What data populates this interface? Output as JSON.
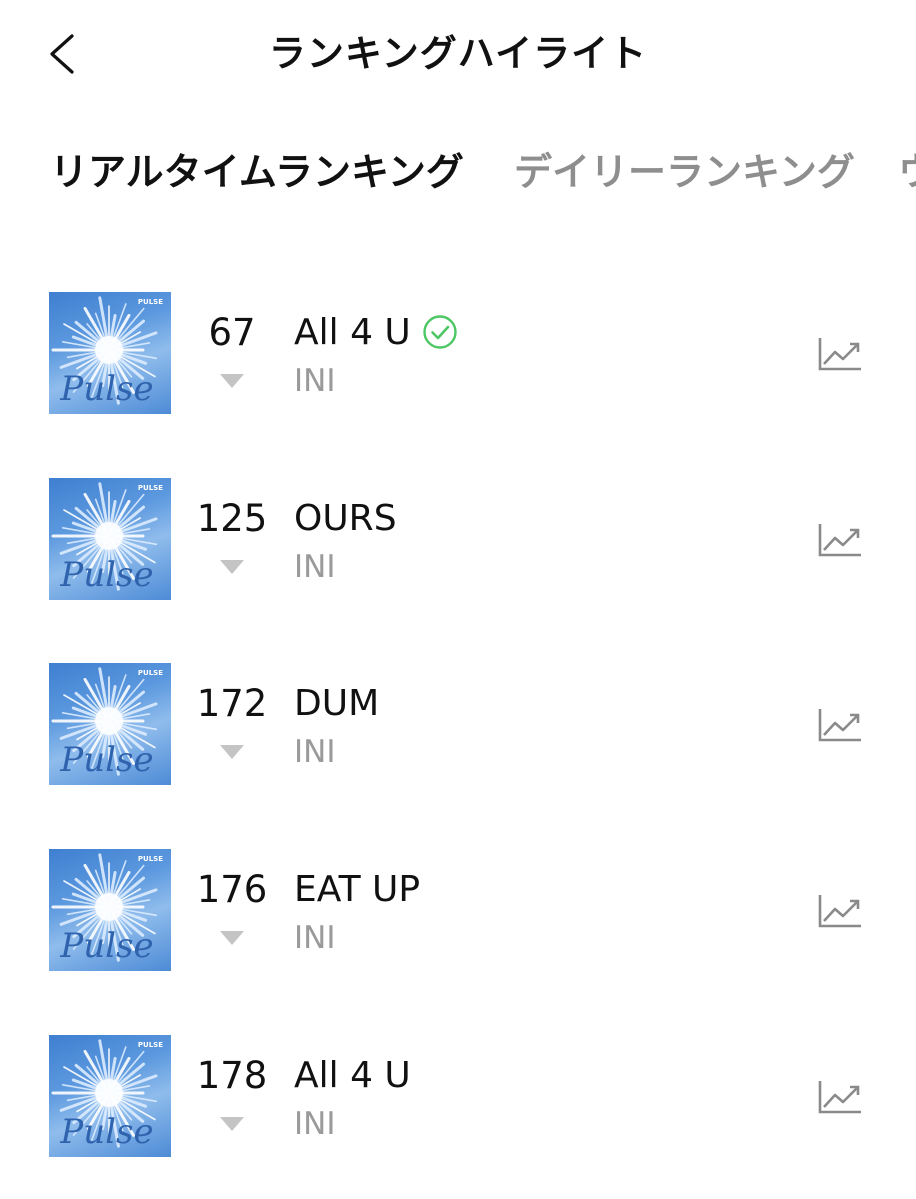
{
  "header": {
    "title": "ランキングハイライト"
  },
  "tabs": [
    {
      "label": "リアルタイムランキング",
      "active": true
    },
    {
      "label": "デイリーランキング",
      "active": false
    },
    {
      "label": "ウ",
      "active": false
    }
  ],
  "cover_art": {
    "brand": "PULSE",
    "script": "Pulse"
  },
  "rows": [
    {
      "rank": "67",
      "title": "All 4 U",
      "artist": "INI",
      "trend": "down",
      "verified": true
    },
    {
      "rank": "125",
      "title": "OURS",
      "artist": "INI",
      "trend": "down",
      "verified": false
    },
    {
      "rank": "172",
      "title": "DUM",
      "artist": "INI",
      "trend": "down",
      "verified": false
    },
    {
      "rank": "176",
      "title": "EAT UP",
      "artist": "INI",
      "trend": "down",
      "verified": false
    },
    {
      "rank": "178",
      "title": "All 4 U",
      "artist": "INI",
      "trend": "down",
      "verified": false
    }
  ],
  "colors": {
    "verified": "#4cc764",
    "trend_down": "#c4c4c4",
    "chart_icon": "#8a8a8a",
    "inactive_tab": "#8e8e8e"
  }
}
